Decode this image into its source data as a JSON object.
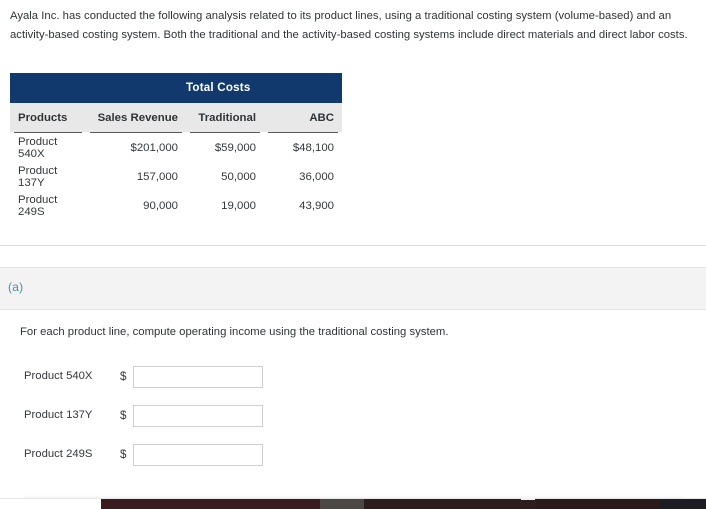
{
  "intro": {
    "text": "Ayala Inc. has conducted the following analysis related to its product lines, using a traditional costing system (volume-based) and an activity-based costing system. Both the traditional and the activity-based costing systems include direct materials and direct labor costs."
  },
  "table": {
    "group_header": "Total Costs",
    "columns": [
      "Products",
      "Sales Revenue",
      "Traditional",
      "ABC"
    ],
    "rows": [
      {
        "product": "Product 540X",
        "sales_revenue": "$201,000",
        "traditional": "$59,000",
        "abc": "$48,100"
      },
      {
        "product": "Product 137Y",
        "sales_revenue": "157,000",
        "traditional": "50,000",
        "abc": "36,000"
      },
      {
        "product": "Product 249S",
        "sales_revenue": "90,000",
        "traditional": "19,000",
        "abc": "43,900"
      }
    ],
    "header_bg": "#12396e",
    "column_header_bg": "#e8e8e8"
  },
  "part": {
    "label": "(a)",
    "label_color": "#4b8fa6",
    "prompt": "For each product line, compute operating income using the traditional costing system."
  },
  "answers": {
    "currency_symbol": "$",
    "rows": [
      {
        "label": "Product 540X",
        "value": "",
        "placeholder": ""
      },
      {
        "label": "Product 137Y",
        "value": "",
        "placeholder": ""
      },
      {
        "label": "Product 249S",
        "value": "",
        "placeholder": ""
      }
    ]
  }
}
